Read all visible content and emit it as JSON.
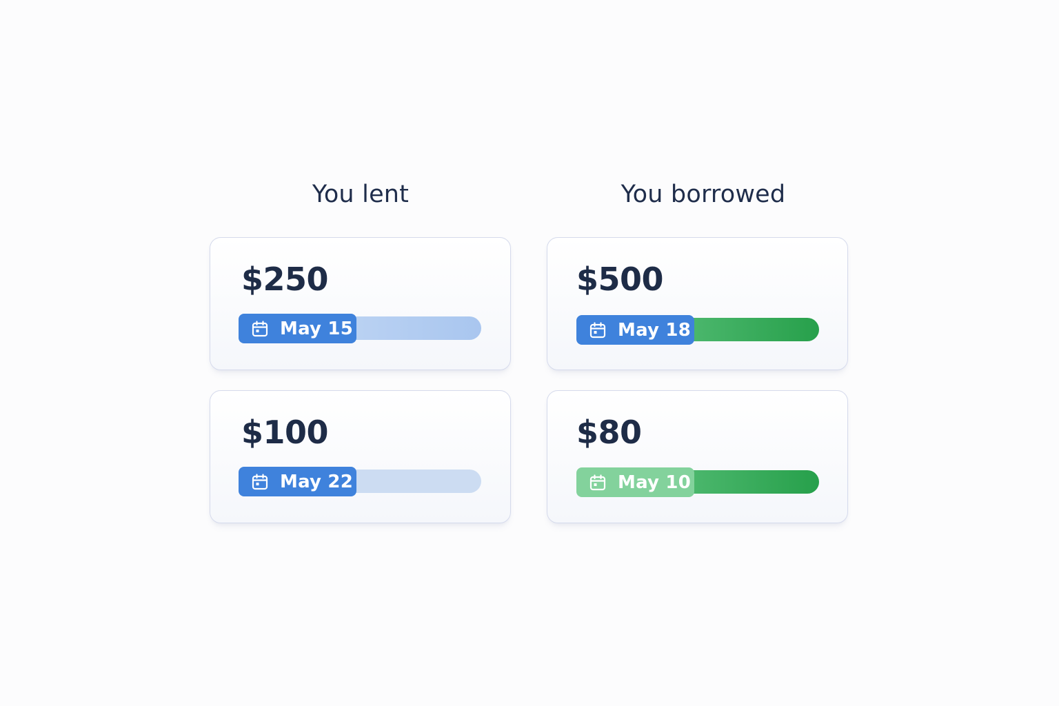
{
  "columns": {
    "lent": {
      "title": "You lent",
      "items": [
        {
          "amount": "$250",
          "due_date": "May 15"
        },
        {
          "amount": "$100",
          "due_date": "May 22"
        }
      ]
    },
    "borrowed": {
      "title": "You borrowed",
      "items": [
        {
          "amount": "$500",
          "due_date": "May 18"
        },
        {
          "amount": "$80",
          "due_date": "May 10"
        }
      ]
    }
  },
  "icons": {
    "date_badge": "calendar-icon"
  },
  "colors": {
    "text_primary": "#1e2c47",
    "lent_accent": "#3f82dc",
    "borrowed_accent": "#27a04b",
    "borrowed_badge_light": "#83d29c"
  }
}
